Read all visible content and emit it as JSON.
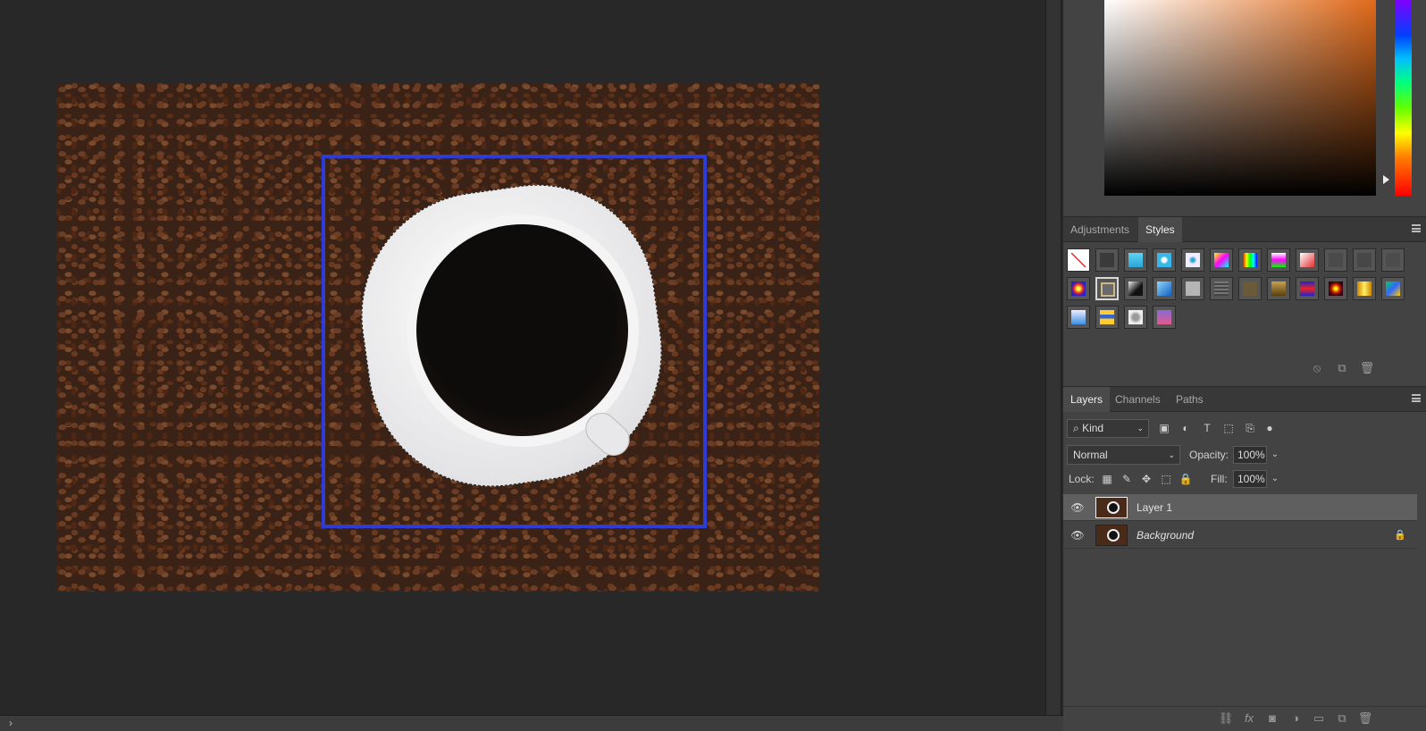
{
  "styles_panel": {
    "tabs": [
      {
        "label": "Adjustments",
        "active": false
      },
      {
        "label": "Styles",
        "active": true
      }
    ]
  },
  "layers_panel": {
    "tabs": [
      {
        "label": "Layers",
        "active": true
      },
      {
        "label": "Channels",
        "active": false
      },
      {
        "label": "Paths",
        "active": false
      }
    ],
    "filter_kind": "Kind",
    "blend_mode": "Normal",
    "opacity_label": "Opacity:",
    "opacity_value": "100%",
    "lock_label": "Lock:",
    "fill_label": "Fill:",
    "fill_value": "100%",
    "layers": [
      {
        "name": "Layer 1",
        "visible": true,
        "selected": true,
        "locked": false
      },
      {
        "name": "Background",
        "visible": true,
        "selected": false,
        "locked": true
      }
    ]
  },
  "colors": {
    "selection_rect": "#2f3bd6",
    "panel_bg": "#434343",
    "workspace_bg": "#282828"
  },
  "icons": {
    "styles_footer": [
      "clear-style-icon",
      "new-style-icon",
      "delete-style-icon"
    ],
    "layer_filters": [
      "image-filter-icon",
      "adjustment-filter-icon",
      "type-filter-icon",
      "shape-filter-icon",
      "smart-object-filter-icon",
      "filter-toggle-icon"
    ],
    "lock_icons": [
      "lock-transparent-pixels-icon",
      "lock-image-pixels-icon",
      "lock-position-icon",
      "lock-artboard-icon",
      "lock-all-icon"
    ],
    "layers_footer": [
      "link-layers-icon",
      "fx-icon",
      "add-mask-icon",
      "adjustment-layer-icon",
      "new-group-icon",
      "new-layer-icon",
      "delete-layer-icon"
    ]
  }
}
